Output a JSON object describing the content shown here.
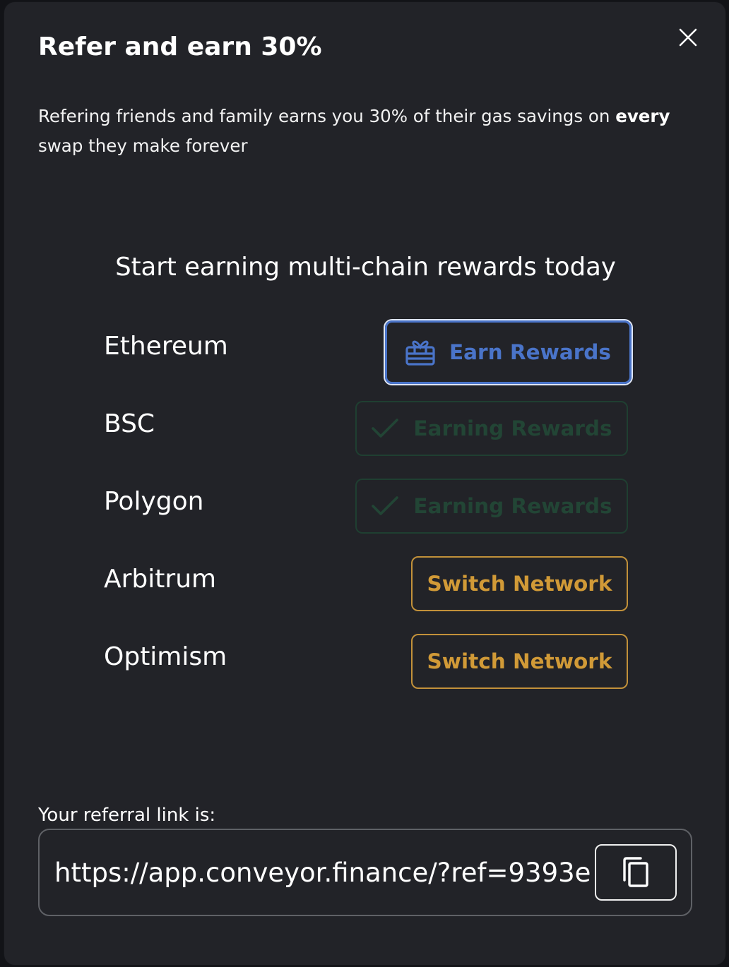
{
  "modal": {
    "title": "Refer and earn 30%",
    "description_pre": "Refering friends and family earns you 30% of their gas savings on ",
    "description_bold": "every",
    "description_post": " swap they make forever",
    "subheading": "Start earning multi-chain rewards today"
  },
  "chains": [
    {
      "name": "Ethereum",
      "action": "Earn Rewards",
      "state": "earn",
      "icon": "gift-icon"
    },
    {
      "name": "BSC",
      "action": "Earning Rewards",
      "state": "earning",
      "icon": "checkmark-icon"
    },
    {
      "name": "Polygon",
      "action": "Earning Rewards",
      "state": "earning",
      "icon": "checkmark-icon"
    },
    {
      "name": "Arbitrum",
      "action": "Switch Network",
      "state": "switch"
    },
    {
      "name": "Optimism",
      "action": "Switch Network",
      "state": "switch"
    }
  ],
  "referral": {
    "label": "Your referral link is:",
    "link": "https://app.conveyor.finance/?ref=9393e",
    "copy_icon": "copy-icon"
  },
  "colors": {
    "background": "#222328",
    "earn_blue": "#4a74c9",
    "earning_green": "#224535",
    "switch_gold": "#d19a37"
  }
}
